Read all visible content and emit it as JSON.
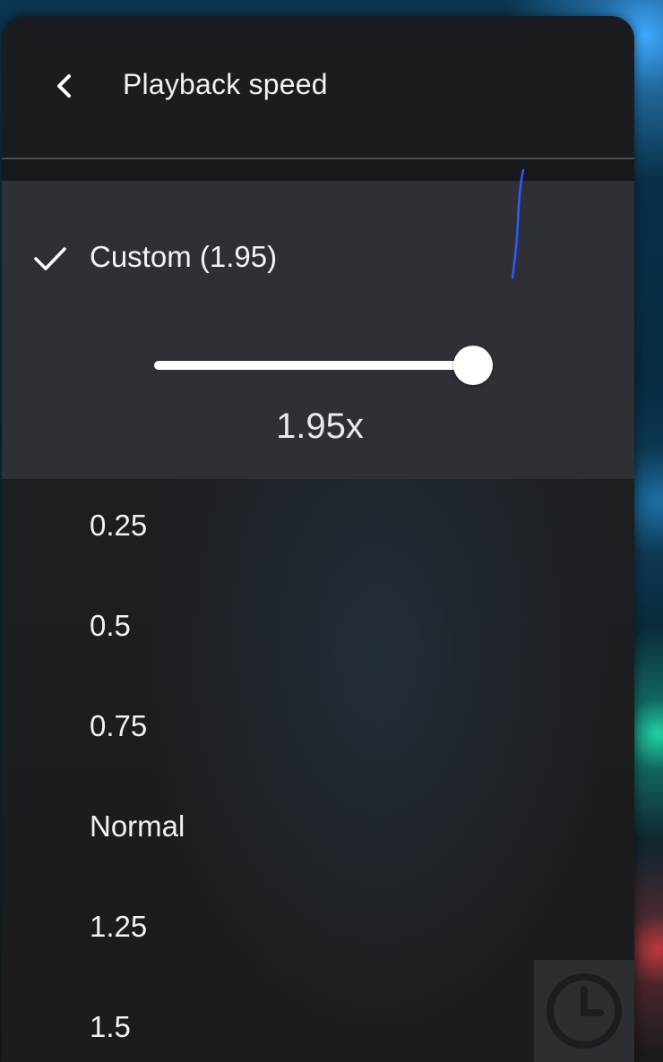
{
  "header": {
    "back_icon": "chevron-left-icon",
    "title": "Playback speed"
  },
  "custom": {
    "check_icon": "checkmark-icon",
    "label": "Custom (1.95)",
    "slider": {
      "min": 0.25,
      "max": 2,
      "value": 1.95
    },
    "value_display": "1.95x"
  },
  "options": [
    {
      "label": "0.25"
    },
    {
      "label": "0.5"
    },
    {
      "label": "0.75"
    },
    {
      "label": "Normal"
    },
    {
      "label": "1.25"
    },
    {
      "label": "1.5"
    }
  ],
  "overlay": {
    "corner_icon": "clock-icon"
  },
  "colors": {
    "panel": "#1d1e21",
    "selected_section": "#2e3035",
    "text": "#f2f2f2",
    "slider_fill": "#ffffff",
    "pen_stroke": "#2f5bff"
  }
}
